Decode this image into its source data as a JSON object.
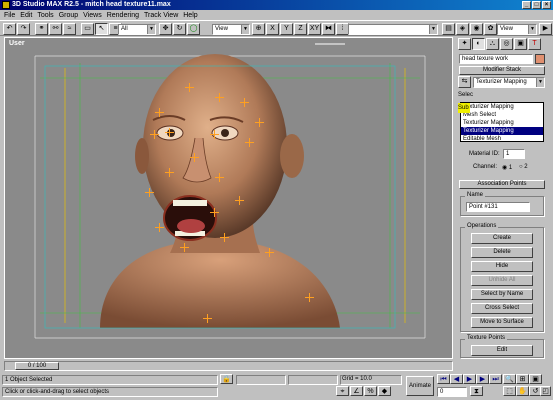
{
  "title": "3D Studio MAX R2.5 - mitch head texture11.max",
  "menus": [
    "File",
    "Edit",
    "Tools",
    "Group",
    "Views",
    "Rendering",
    "Track View",
    "Help"
  ],
  "toolbar": {
    "selection_filter": "All",
    "ref_coord": "View",
    "axis_x": "X",
    "axis_y": "Y",
    "axis_z": "Z",
    "axis_xy": "XY",
    "named_selection": "",
    "viewport_dd": "View"
  },
  "viewport": {
    "label": "User"
  },
  "panel": {
    "object_name": "head texure work",
    "modifier_stack_title": "Modifier Stack",
    "stack_selected": "Texturizer Mapping",
    "stack_list": [
      "Texturizer Mapping",
      "Mesh Select",
      "Texturizer Mapping",
      "Texturizer Mapping",
      "Editable Mesh"
    ],
    "sel_label": "Selec",
    "sub_label": "Sub",
    "material_id_label": "Material ID:",
    "material_id_value": "1",
    "channel_label": "Channel:",
    "channel_1": "1",
    "channel_2": "2",
    "assoc_rollout": "Association Points",
    "name_group": "Name",
    "name_value": "Point #131",
    "operations_group": "Operations",
    "ops": [
      "Create",
      "Delete",
      "Hide",
      "Unhide All",
      "Select by Name",
      "Cross Select",
      "Move to Surface"
    ],
    "texture_points_group": "Texture Points",
    "edit_label": "Edit"
  },
  "timeline": {
    "frame": "0 / 100"
  },
  "status": {
    "selected": "1 Object Selected",
    "prompt": "Click or click-and-drag to select objects",
    "grid": "Grid = 10.0",
    "animate": "Animate",
    "frame_value": "0"
  },
  "colors": {
    "title_start": "#00006e",
    "title_end": "#1084d0",
    "skin": "#c08a66",
    "highlight": "#ffa020"
  }
}
